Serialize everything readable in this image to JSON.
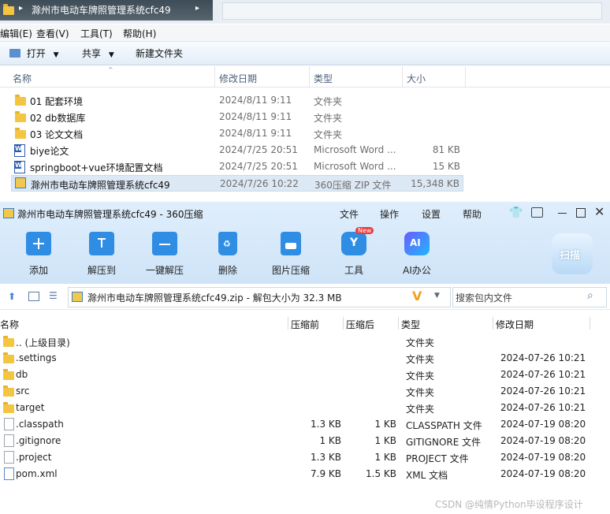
{
  "explorer": {
    "path": "滁州市电动车牌照管理系统cfc49",
    "menu": [
      "编辑(E)",
      "查看(V)",
      "工具(T)",
      "帮助(H)"
    ],
    "commands": {
      "open": "打开",
      "share": "共享",
      "new_folder": "新建文件夹"
    },
    "columns": {
      "name": "名称",
      "date": "修改日期",
      "type": "类型",
      "size": "大小"
    },
    "files": [
      {
        "name": "01 配套环境",
        "date": "2024/8/11 9:11",
        "type": "文件夹",
        "size": "",
        "icon": "folder-icon"
      },
      {
        "name": "02 db数据库",
        "date": "2024/8/11 9:11",
        "type": "文件夹",
        "size": "",
        "icon": "folder-icon"
      },
      {
        "name": "03 论文文档",
        "date": "2024/8/11 9:11",
        "type": "文件夹",
        "size": "",
        "icon": "folder-icon"
      },
      {
        "name": "biye论文",
        "date": "2024/7/25 20:51",
        "type": "Microsoft Word ...",
        "size": "81 KB",
        "icon": "word-icon"
      },
      {
        "name": "springboot+vue环境配置文档",
        "date": "2024/7/25 20:51",
        "type": "Microsoft Word ...",
        "size": "15 KB",
        "icon": "word-icon"
      },
      {
        "name": "滁州市电动车牌照管理系统cfc49",
        "date": "2024/7/26 10:22",
        "type": "360压缩 ZIP 文件",
        "size": "15,348 KB",
        "icon": "zip-icon"
      }
    ]
  },
  "zip": {
    "title": "滁州市电动车牌照管理系统cfc49 - 360压缩",
    "menu": [
      "文件",
      "操作",
      "设置",
      "帮助"
    ],
    "tools": [
      {
        "label": "添加",
        "icon": "add-icon"
      },
      {
        "label": "解压到",
        "icon": "extract-to-icon"
      },
      {
        "label": "一键解压",
        "icon": "one-click-extract-icon"
      },
      {
        "label": "删除",
        "icon": "delete-icon"
      },
      {
        "label": "图片压缩",
        "icon": "image-compress-icon"
      },
      {
        "label": "工具",
        "icon": "tools-icon",
        "badge": "New"
      },
      {
        "label": "AI办公",
        "icon": "ai-office-icon"
      }
    ],
    "scan_label": "扫描",
    "path_text": "滁州市电动车牌照管理系统cfc49.zip - 解包大小为 32.3 MB",
    "search_placeholder": "搜索包内文件",
    "columns": {
      "name": "名称",
      "before": "压缩前",
      "after": "压缩后",
      "type": "类型",
      "date": "修改日期"
    },
    "entries": [
      {
        "name": ".. (上级目录)",
        "before": "",
        "after": "",
        "type": "文件夹",
        "date": "",
        "icon": "folder-icon"
      },
      {
        "name": ".settings",
        "before": "",
        "after": "",
        "type": "文件夹",
        "date": "2024-07-26 10:21",
        "icon": "folder-icon"
      },
      {
        "name": "db",
        "before": "",
        "after": "",
        "type": "文件夹",
        "date": "2024-07-26 10:21",
        "icon": "folder-icon"
      },
      {
        "name": "src",
        "before": "",
        "after": "",
        "type": "文件夹",
        "date": "2024-07-26 10:21",
        "icon": "folder-icon"
      },
      {
        "name": "target",
        "before": "",
        "after": "",
        "type": "文件夹",
        "date": "2024-07-26 10:21",
        "icon": "folder-icon"
      },
      {
        "name": ".classpath",
        "before": "1.3 KB",
        "after": "1 KB",
        "type": "CLASSPATH 文件",
        "date": "2024-07-19 08:20",
        "icon": "file-icon"
      },
      {
        "name": ".gitignore",
        "before": "1 KB",
        "after": "1 KB",
        "type": "GITIGNORE 文件",
        "date": "2024-07-19 08:20",
        "icon": "file-icon"
      },
      {
        "name": ".project",
        "before": "1.3 KB",
        "after": "1 KB",
        "type": "PROJECT 文件",
        "date": "2024-07-19 08:20",
        "icon": "file-icon"
      },
      {
        "name": "pom.xml",
        "before": "7.9 KB",
        "after": "1.5 KB",
        "type": "XML 文档",
        "date": "2024-07-19 08:20",
        "icon": "xml-file-icon"
      }
    ]
  },
  "watermark": "CSDN @纯情Python毕设程序设计"
}
